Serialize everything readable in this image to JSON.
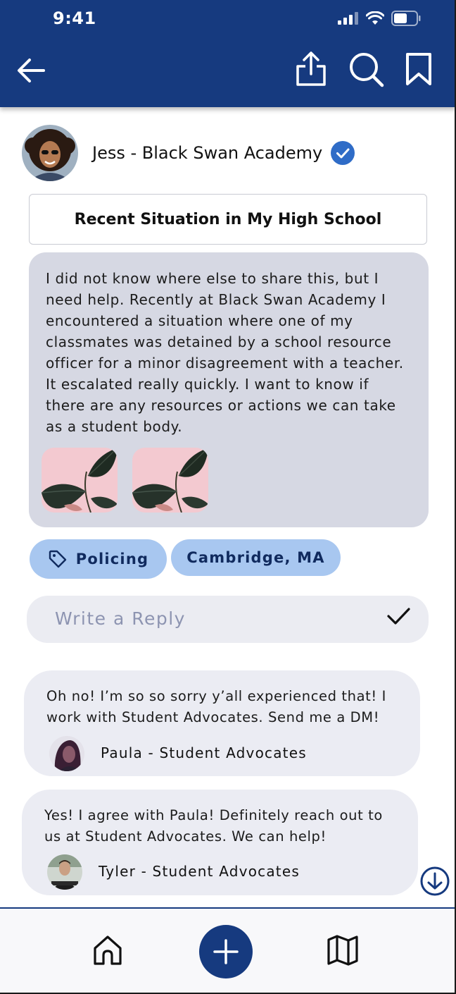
{
  "status_bar": {
    "time": "9:41"
  },
  "post": {
    "author": "Jess - Black Swan Academy",
    "title": "Recent Situation in My High School",
    "body": "I did not know where else to share this, but I need help. Recently at Black Swan Academy I encountered a situation where one of my classmates was detained by a school resource officer for a minor disagreement with a teacher. It escalated really quickly. I want to know if there are any resources or actions we can take as a student body.",
    "tags": {
      "topic": "Policing",
      "location": "Cambridge, MA"
    }
  },
  "reply": {
    "placeholder": "Write a Reply"
  },
  "comments": [
    {
      "text": "Oh no! I’m so so sorry y’all experienced that! I work with Student Advocates. Send me a DM!",
      "author": "Paula - Student Advocates"
    },
    {
      "text": "Yes! I agree with Paula! Definitely reach out to us at Student Advocates. We can help!",
      "author": "Tyler - Student Advocates"
    }
  ],
  "colors": {
    "brand": "#163a7f",
    "chip": "#a8c7f0",
    "post_bg": "#d6d8e3",
    "comment_bg": "#ebecf3",
    "verified": "#2f6cc7"
  },
  "icons": {
    "header": [
      "back-arrow-icon",
      "share-icon",
      "search-icon",
      "bookmark-icon"
    ],
    "tabbar": [
      "home-icon",
      "add-icon",
      "map-icon"
    ]
  }
}
